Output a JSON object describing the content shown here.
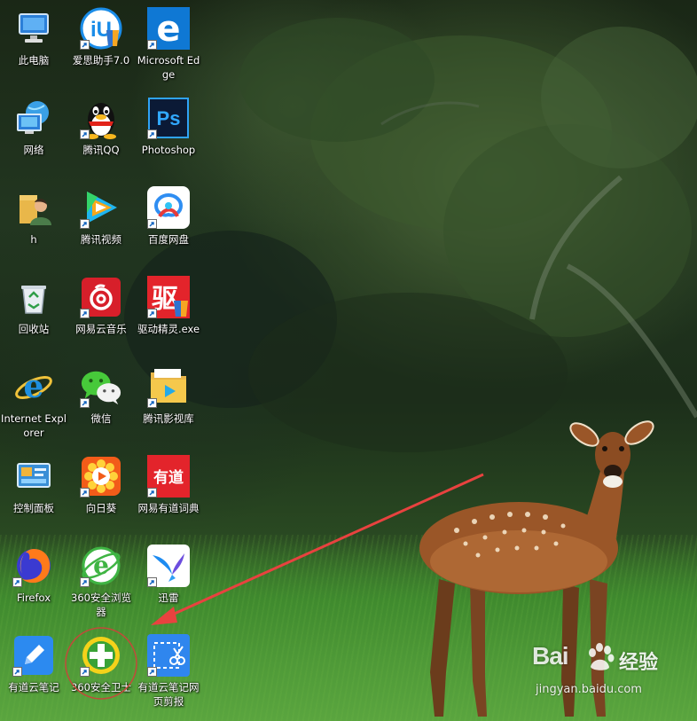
{
  "desktop": {
    "icons": [
      {
        "label": "此电脑",
        "icon": "computer-icon",
        "shortcut": false
      },
      {
        "label": "网络",
        "icon": "network-icon",
        "shortcut": false
      },
      {
        "label": "h",
        "icon": "user-folder-icon",
        "shortcut": false
      },
      {
        "label": "回收站",
        "icon": "recycle-bin-icon",
        "shortcut": false
      },
      {
        "label": "Internet Explorer",
        "icon": "internet-explorer-icon",
        "shortcut": false
      },
      {
        "label": "控制面板",
        "icon": "control-panel-icon",
        "shortcut": false
      },
      {
        "label": "Firefox",
        "icon": "firefox-icon",
        "shortcut": true
      },
      {
        "label": "有道云笔记",
        "icon": "youdao-note-icon",
        "shortcut": true
      },
      {
        "label": "爱思助手7.0",
        "icon": "i4-assistant-icon",
        "shortcut": true
      },
      {
        "label": "腾讯QQ",
        "icon": "qq-penguin-icon",
        "shortcut": true
      },
      {
        "label": "腾讯视频",
        "icon": "tencent-video-icon",
        "shortcut": true
      },
      {
        "label": "网易云音乐",
        "icon": "netease-music-icon",
        "shortcut": true
      },
      {
        "label": "微信",
        "icon": "wechat-icon",
        "shortcut": true
      },
      {
        "label": "向日葵",
        "icon": "sunflower-icon",
        "shortcut": true
      },
      {
        "label": "360安全浏览器",
        "icon": "360-browser-icon",
        "shortcut": true
      },
      {
        "label": "360安全卫士",
        "icon": "360-safe-icon",
        "shortcut": true
      },
      {
        "label": "Microsoft Edge",
        "icon": "edge-icon",
        "shortcut": true
      },
      {
        "label": "Photoshop",
        "icon": "photoshop-icon",
        "shortcut": true
      },
      {
        "label": "百度网盘",
        "icon": "baidu-netdisk-icon",
        "shortcut": true
      },
      {
        "label": "驱动精灵.exe",
        "icon": "driver-genius-icon",
        "shortcut": true
      },
      {
        "label": "腾讯影视库",
        "icon": "video-folder-icon",
        "shortcut": true
      },
      {
        "label": "网易有道词典",
        "icon": "youdao-dict-icon",
        "shortcut": true
      },
      {
        "label": "迅雷",
        "icon": "xunlei-bird-icon",
        "shortcut": true
      },
      {
        "label": "有道云笔记网页剪报",
        "icon": "web-clipper-icon",
        "shortcut": true
      }
    ],
    "glyphs": {
      "edge": "e",
      "photoshop": "Ps",
      "ie": "e",
      "driver": "驱",
      "youdao_dict": "有道",
      "i4": "iU"
    },
    "annotation": {
      "arrow_color": "#e8423f",
      "circle_color": "#c24a3a"
    }
  },
  "watermark": {
    "logo": "Bai",
    "brand": "经验",
    "url": "jingyan.baidu.com"
  }
}
